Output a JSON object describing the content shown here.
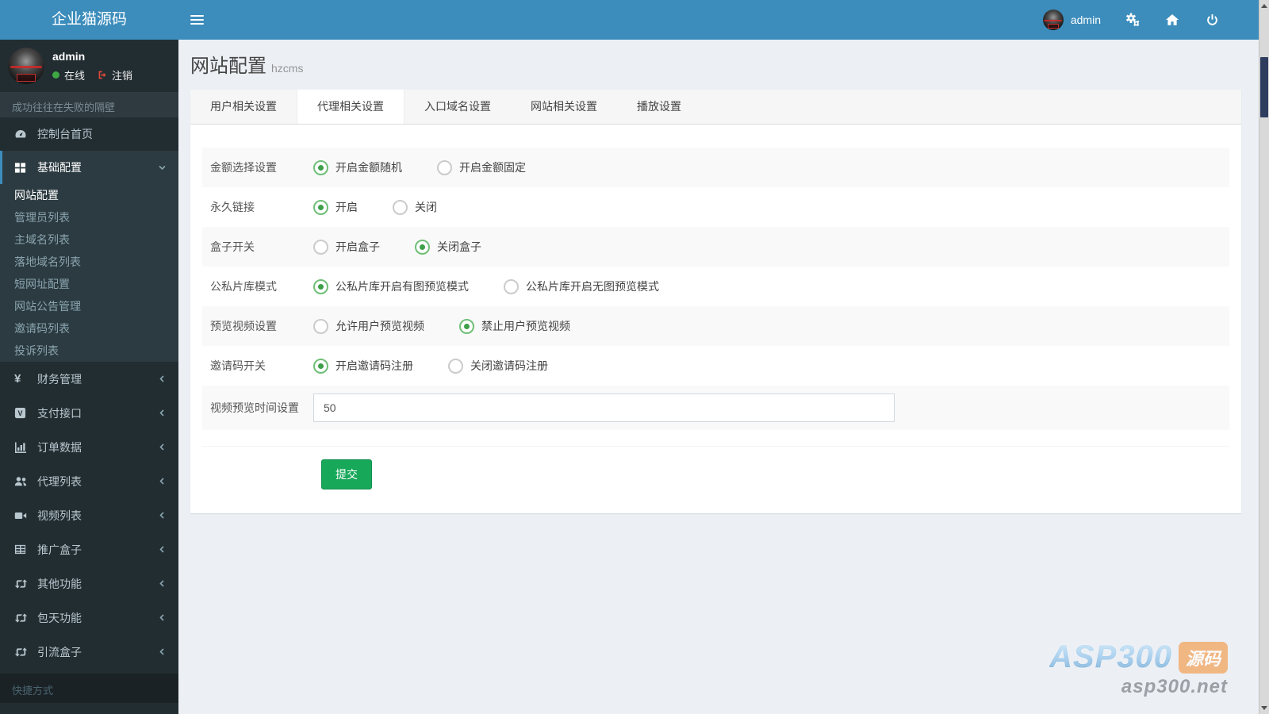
{
  "brand": "企业猫源码",
  "navbar": {
    "user": "admin",
    "icons": [
      "cogs-icon",
      "home-icon",
      "power-icon"
    ]
  },
  "sidebar": {
    "user": {
      "name": "admin",
      "status": "在线",
      "logout": "注销"
    },
    "motto": "成功往往在失败的隔壁",
    "menu": [
      {
        "label": "控制台首页",
        "icon": "dashboard-icon"
      },
      {
        "label": "基础配置",
        "icon": "grid-icon",
        "expanded": true,
        "active": true,
        "children": [
          {
            "label": "网站配置",
            "active": true
          },
          {
            "label": "管理员列表",
            "active": false
          },
          {
            "label": "主域名列表",
            "active": false
          },
          {
            "label": "落地域名列表",
            "active": false
          },
          {
            "label": "短网址配置",
            "active": false
          },
          {
            "label": "网站公告管理",
            "active": false
          },
          {
            "label": "邀请码列表",
            "active": false
          },
          {
            "label": "投诉列表",
            "active": false
          }
        ]
      },
      {
        "label": "财务管理",
        "icon": "yen-icon",
        "icon_glyph": "¥"
      },
      {
        "label": "支付接口",
        "icon": "vimeo-icon"
      },
      {
        "label": "订单数据",
        "icon": "bar-chart-icon"
      },
      {
        "label": "代理列表",
        "icon": "users-icon"
      },
      {
        "label": "视频列表",
        "icon": "video-camera-icon"
      },
      {
        "label": "推广盒子",
        "icon": "table-icon"
      },
      {
        "label": "其他功能",
        "icon": "retweet-icon"
      },
      {
        "label": "包天功能",
        "icon": "retweet-icon"
      },
      {
        "label": "引流盒子",
        "icon": "retweet-icon"
      }
    ],
    "footer_header": "快捷方式"
  },
  "page": {
    "title": "网站配置",
    "subtitle": "hzcms"
  },
  "tabs": [
    {
      "label": "用户相关设置",
      "active": false
    },
    {
      "label": "代理相关设置",
      "active": true
    },
    {
      "label": "入口域名设置",
      "active": false
    },
    {
      "label": "网站相关设置",
      "active": false
    },
    {
      "label": "播放设置",
      "active": false
    }
  ],
  "form": {
    "rows": [
      {
        "label": "金额选择设置",
        "options": [
          {
            "text": "开启金额随机",
            "selected": true
          },
          {
            "text": "开启金额固定",
            "selected": false
          }
        ]
      },
      {
        "label": "永久链接",
        "options": [
          {
            "text": "开启",
            "selected": true
          },
          {
            "text": "关闭",
            "selected": false
          }
        ]
      },
      {
        "label": "盒子开关",
        "options": [
          {
            "text": "开启盒子",
            "selected": false
          },
          {
            "text": "关闭盒子",
            "selected": true
          }
        ]
      },
      {
        "label": "公私片库模式",
        "options": [
          {
            "text": "公私片库开启有图预览模式",
            "selected": true
          },
          {
            "text": "公私片库开启无图预览模式",
            "selected": false
          }
        ]
      },
      {
        "label": "预览视频设置",
        "options": [
          {
            "text": "允许用户预览视频",
            "selected": false
          },
          {
            "text": "禁止用户预览视频",
            "selected": true
          }
        ]
      },
      {
        "label": "邀请码开关",
        "options": [
          {
            "text": "开启邀请码注册",
            "selected": true
          },
          {
            "text": "关闭邀请码注册",
            "selected": false
          }
        ]
      }
    ],
    "input_row": {
      "label": "视频预览时间设置",
      "value": "50"
    },
    "submit_label": "提交"
  },
  "watermark": {
    "line1": "ASP300",
    "badge": "源码",
    "line2": "asp300.net"
  },
  "colors": {
    "accent": "#3c8dbc",
    "sidebar_bg": "#222d32",
    "submenu_bg": "#2c3b41",
    "success_green": "#18a85a",
    "radio_green": "#3f9e4a",
    "logout_red": "#dd4b39",
    "page_bg": "#ecf0f5",
    "badge_orange": "#f3a55e"
  }
}
